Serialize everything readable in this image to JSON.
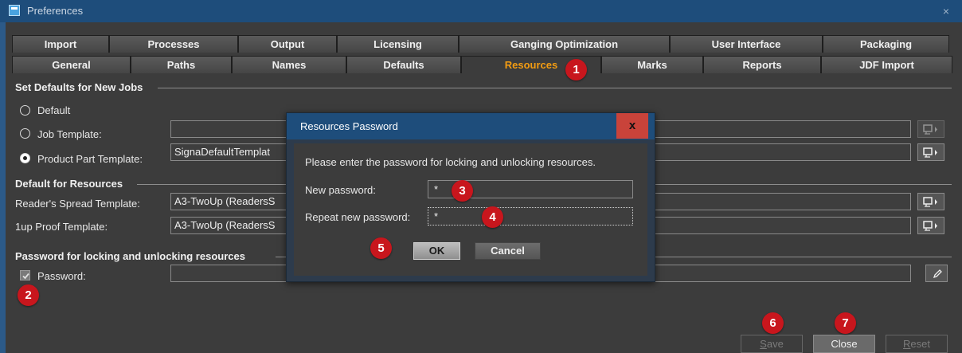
{
  "window": {
    "title": "Preferences",
    "close_glyph": "×",
    "icon": "app-icon"
  },
  "tabs_row1": [
    "Import",
    "Processes",
    "Output",
    "Licensing",
    "Ganging Optimization",
    "User Interface",
    "Packaging"
  ],
  "tabs_row2": [
    "General",
    "Paths",
    "Names",
    "Defaults",
    "Resources",
    "Marks",
    "Reports",
    "JDF Import"
  ],
  "active_tab": "Resources",
  "accent_color": "#f39c12",
  "marker_color": "#c8161d",
  "set_defaults": {
    "heading": "Set Defaults for New Jobs",
    "default_label": "Default",
    "job_template_label": "Job Template:",
    "job_template_value": "",
    "product_part_label": "Product Part Template:",
    "product_part_value": "SignaDefaultTemplat",
    "selected": "Product Part Template"
  },
  "default_resources": {
    "heading": "Default for Resources",
    "readers_label": "Reader's Spread Template:",
    "readers_value": "A3-TwoUp (ReadersS",
    "proof_label": "1up Proof Template:",
    "proof_value": "A3-TwoUp (ReadersS"
  },
  "password_section": {
    "heading": "Password for locking and unlocking resources",
    "checkbox_label": "Password:",
    "checked": true,
    "value": ""
  },
  "markers": [
    "1",
    "2",
    "3",
    "4",
    "5",
    "6",
    "7"
  ],
  "buttons": {
    "save_u": "S",
    "save_rest": "ave",
    "close": "Close",
    "reset_u": "R",
    "reset_rest": "eset"
  },
  "dialog": {
    "title": "Resources Password",
    "close_glyph": "x",
    "prompt": "Please enter the password for locking and unlocking resources.",
    "new_password_label": "New password:",
    "new_password_value": "*",
    "repeat_password_label": "Repeat new password:",
    "repeat_password_value": "*",
    "ok_label": "OK",
    "cancel_label": "Cancel"
  }
}
